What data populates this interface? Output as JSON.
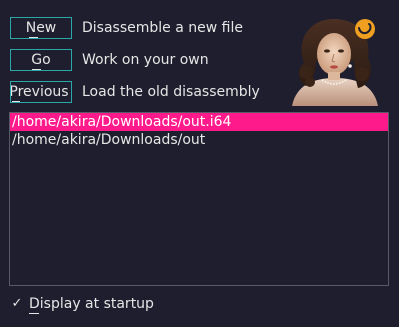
{
  "actions": [
    {
      "button_label": "New",
      "mnemonic": "N",
      "description": "Disassemble a new file"
    },
    {
      "button_label": "Go",
      "mnemonic": "G",
      "description": "Work on your own"
    },
    {
      "button_label": "Previous",
      "mnemonic": "P",
      "description": "Load the old disassembly"
    }
  ],
  "recent_files": {
    "items": [
      "/home/akira/Downloads/out.i64",
      "/home/akira/Downloads/out"
    ],
    "selected_index": 0
  },
  "startup": {
    "checked": true,
    "check_glyph": "✓",
    "label": "Display at startup",
    "mnemonic": "D"
  },
  "colors": {
    "background": "#1e1e2e",
    "button_border": "#2aa7a8",
    "selection": "#ff1a8c",
    "text": "#e6e6e6",
    "badge": "#f0a020"
  },
  "icons": {
    "portrait": "portrait-image",
    "badge": "ida-logo-icon"
  }
}
